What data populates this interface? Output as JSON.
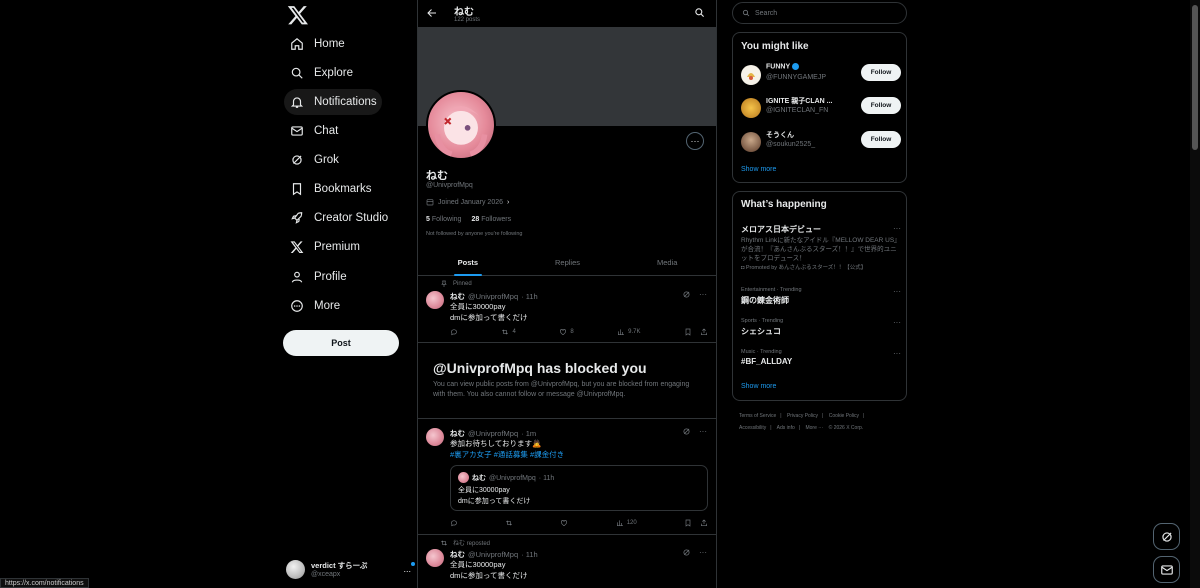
{
  "statusbar": {
    "url": "https://x.com/notifications"
  },
  "nav": {
    "items": [
      {
        "label": "Home",
        "icon": "home-icon"
      },
      {
        "label": "Explore",
        "icon": "search-icon"
      },
      {
        "label": "Notifications",
        "icon": "bell-icon"
      },
      {
        "label": "Chat",
        "icon": "mail-icon"
      },
      {
        "label": "Grok",
        "icon": "grok-icon"
      },
      {
        "label": "Bookmarks",
        "icon": "bookmark-icon"
      },
      {
        "label": "Creator Studio",
        "icon": "rocket-icon"
      },
      {
        "label": "Premium",
        "icon": "x-logo-icon"
      },
      {
        "label": "Profile",
        "icon": "person-icon"
      },
      {
        "label": "More",
        "icon": "more-circle-icon"
      }
    ],
    "post_label": "Post",
    "account": {
      "name": "verdict すらーぷ",
      "handle": "@xceapx",
      "more": "..."
    }
  },
  "profile": {
    "top_name": "ねむ",
    "post_count": "122 posts",
    "name": "ねむ",
    "handle": "@UnivprofMpq",
    "joined": "Joined January 2026",
    "following_count": "5",
    "following_label": "Following",
    "followers_count": "28",
    "followers_label": "Followers",
    "not_followed": "Not followed by anyone you're following",
    "more": "···"
  },
  "tabs": [
    "Posts",
    "Replies",
    "Media"
  ],
  "tweets": {
    "pinned_label": "Pinned",
    "t1": {
      "name": "ねむ",
      "handle": "@UnivprofMpq",
      "time": "· 11h",
      "line1": "全員に30000pay",
      "line2": "dmに参加って書くだけ",
      "reposts": "4",
      "likes": "8",
      "views": "9.7K"
    },
    "t2": {
      "name": "ねむ",
      "handle": "@UnivprofMpq",
      "time": "· 1m",
      "line1": "参加お待ちしております🙇",
      "hashtags": "#裏アカ女子 #通話募集 #課金付き",
      "views": "120",
      "quote": {
        "name": "ねむ",
        "handle": "@UnivprofMpq",
        "time": "· 11h",
        "line1": "全員に30000pay",
        "line2": "dmに参加って書くだけ"
      }
    },
    "repost_label": "ねむ reposted",
    "t3": {
      "name": "ねむ",
      "handle": "@UnivprofMpq",
      "time": "· 11h",
      "line1": "全員に30000pay",
      "line2": "dmに参加って書くだけ"
    },
    "more": "···"
  },
  "blocked": {
    "title": "@UnivprofMpq has blocked you",
    "body": "You can view public posts from @UnivprofMpq, but you are blocked from engaging with them. You also cannot follow or message @UnivprofMpq."
  },
  "right": {
    "search_placeholder": "Search",
    "wtf_title": "You might like",
    "wtf": [
      {
        "name": "FUNNY",
        "handle": "@FUNNYGAMEJP",
        "follow": "Follow"
      },
      {
        "name": "IGNITE 親子CLAN ...",
        "handle": "@IGNITECLAN_FN",
        "follow": "Follow"
      },
      {
        "name": "そうくん",
        "handle": "@soukun2525_",
        "follow": "Follow"
      }
    ],
    "show_more": "Show more",
    "happening_title": "What’s happening",
    "trends": [
      {
        "meta": "",
        "name": "メロアス日本デビュー",
        "desc": "Rhythm Linkに新たなアイドル『MELLOW DEAR US』が合流！『あんさんぶるスターズ！！』で世界的ユニットをプロデュース！",
        "promo": "Promoted by あんさんぶるスターズ！！【公式】"
      },
      {
        "meta": "Entertainment · Trending",
        "name": "鋼の錬金術師",
        "desc": "",
        "promo": ""
      },
      {
        "meta": "Sports · Trending",
        "name": "シェシュコ",
        "desc": "",
        "promo": ""
      },
      {
        "meta": "Music · Trending",
        "name": "#BF_ALLDAY",
        "desc": "",
        "promo": ""
      }
    ],
    "trend_more": "···",
    "footer": [
      "Terms of Service",
      "|",
      "Privacy Policy",
      "|",
      "Cookie Policy",
      "|",
      "Accessibility",
      "|",
      "Ads info",
      "|",
      "More ···",
      "© 2026 X Corp."
    ]
  },
  "colors": {
    "accent": "#1d9bf0",
    "bg": "#000000",
    "border": "#2f3336",
    "muted": "#71767b"
  }
}
